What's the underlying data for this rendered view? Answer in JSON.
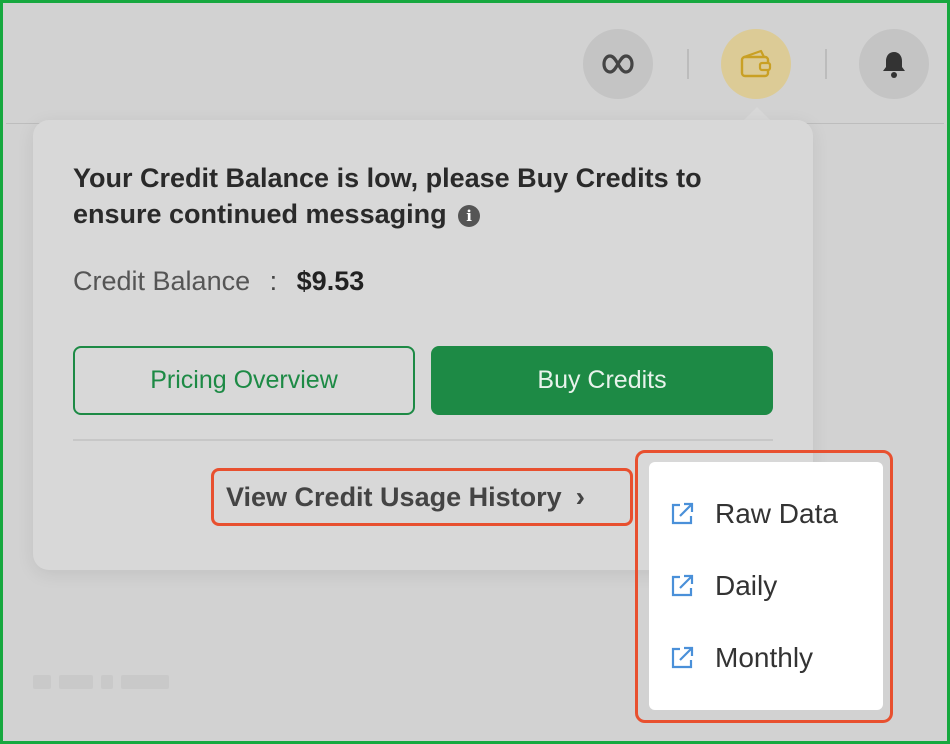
{
  "header": {
    "meta_icon": "meta-infinity-icon",
    "wallet_icon": "wallet-icon",
    "bell_icon": "bell-icon",
    "accent_color": "#dccb96"
  },
  "popover": {
    "message": "Your Credit Balance is low, please Buy Credits to ensure continued messaging",
    "info_icon": "i",
    "balance_label": "Credit Balance",
    "balance_separator": ":",
    "balance_value": "$9.53",
    "pricing_button": "Pricing Overview",
    "buy_button": "Buy Credits",
    "history_link": "View Credit Usage History",
    "history_chevron": "›",
    "brand_color": "#1d8a45"
  },
  "dropdown": {
    "items": [
      {
        "label": "Raw Data",
        "icon": "external-link-icon"
      },
      {
        "label": "Daily",
        "icon": "external-link-icon"
      },
      {
        "label": "Monthly",
        "icon": "external-link-icon"
      }
    ],
    "icon_color": "#4a90d9",
    "highlight_color": "#e8502f"
  }
}
